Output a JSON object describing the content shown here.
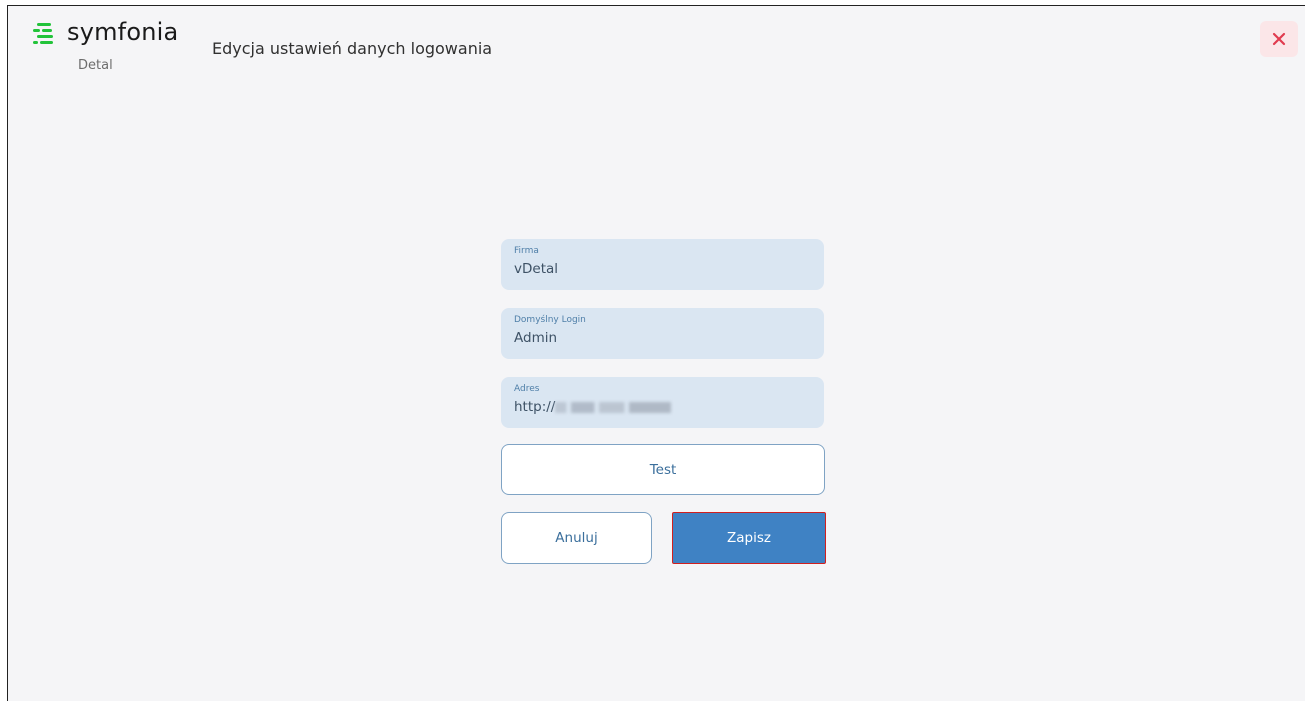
{
  "header": {
    "logo_text": "symfonia",
    "logo_subtitle": "Detal",
    "page_title": "Edycja ustawień danych logowania",
    "close_icon": "close-icon",
    "close_color": "#e03c4f"
  },
  "form": {
    "company": {
      "label": "Firma",
      "value": "vDetal"
    },
    "login": {
      "label": "Domyślny Login",
      "value": "Admin"
    },
    "address": {
      "label": "Adres",
      "value_prefix": "http://"
    }
  },
  "buttons": {
    "test": "Test",
    "cancel": "Anuluj",
    "save": "Zapisz"
  },
  "colors": {
    "brand_green": "#22c33a",
    "primary": "#3f82c4",
    "field_bg": "#dae6f2"
  }
}
